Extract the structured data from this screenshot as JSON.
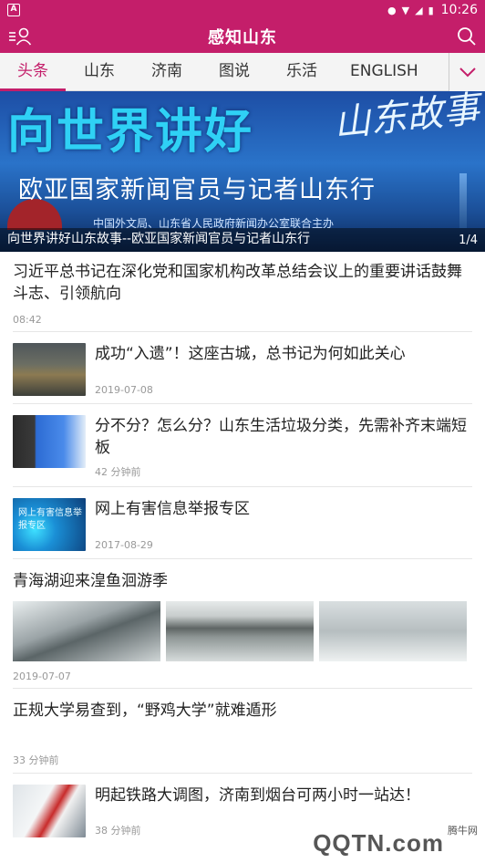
{
  "status_bar": {
    "time": "10:26",
    "app_badge": "A"
  },
  "header": {
    "title": "感知山东"
  },
  "tabs": [
    {
      "label": "头条",
      "active": true
    },
    {
      "label": "山东"
    },
    {
      "label": "济南"
    },
    {
      "label": "图说"
    },
    {
      "label": "乐活"
    },
    {
      "label": "ENGLISH"
    }
  ],
  "banner": {
    "big_title": "向世界讲好",
    "story_text": "山东故事",
    "subtitle": "欧亚国家新闻官员与记者山东行",
    "host": "中国外文局、山东省人民政府新闻办公室联合主办",
    "caption": "向世界讲好山东故事--欧亚国家新闻官员与记者山东行",
    "pager": "1/4"
  },
  "feed": {
    "top_story": {
      "headline": "习近平总书记在深化党和国家机构改革总结会议上的重要讲话鼓舞斗志、引领航向",
      "time": "08:42"
    },
    "row_items": [
      {
        "headline": "成功“入遗”！这座古城，总书记为何如此关心",
        "time": "2019-07-08"
      },
      {
        "headline": "分不分？怎么分？山东生活垃圾分类，先需补齐末端短板",
        "time": "42 分钟前"
      },
      {
        "headline": "网上有害信息举报专区",
        "time": "2017-08-29",
        "thumb_text": "网上有害信息举报专区"
      }
    ],
    "gallery_story": {
      "headline": "青海湖迎来湟鱼洄游季",
      "time": "2019-07-07"
    },
    "text_story": {
      "headline": "正规大学易查到，“野鸡大学”就难遁形",
      "time": "33 分钟前"
    },
    "last_item": {
      "headline": "明起铁路大调图，济南到烟台可两小时一站达！",
      "time": "38 分钟前"
    }
  },
  "watermark": {
    "text": "QQTN.com",
    "site": "腾牛网"
  },
  "colors": {
    "brand": "#c41e6a",
    "meta": "#999999"
  }
}
